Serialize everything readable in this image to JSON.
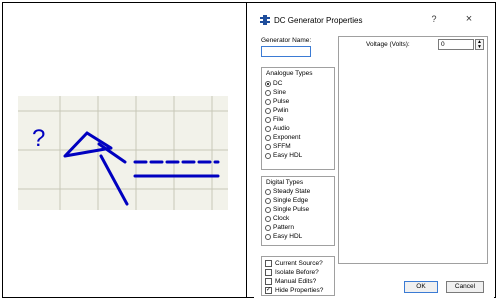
{
  "dialog": {
    "title": "DC Generator Properties",
    "help": "?",
    "close": "×",
    "generator_name_label": "Generator Name:",
    "generator_name_value": "",
    "analogue_group_title": "Analogue Types",
    "analogue_types": [
      "DC",
      "Sine",
      "Pulse",
      "Pwlin",
      "File",
      "Audio",
      "Exponent",
      "SFFM",
      "Easy HDL"
    ],
    "analogue_selected": "DC",
    "digital_group_title": "Digital Types",
    "digital_types": [
      "Steady State",
      "Single Edge",
      "Single Pulse",
      "Clock",
      "Pattern",
      "Easy HDL"
    ],
    "checkboxes": [
      {
        "label": "Current Source?",
        "checked": false
      },
      {
        "label": "Isolate Before?",
        "checked": false
      },
      {
        "label": "Manual Edits?",
        "checked": false
      },
      {
        "label": "Hide Properties?",
        "checked": true
      }
    ],
    "voltage_label": "Voltage (Volts):",
    "voltage_value": "0",
    "ok_label": "OK",
    "cancel_label": "Cancel"
  },
  "schematic": {
    "generator_value": "?",
    "wire_color": "#0000c0",
    "grid_color": "#c8c8b8",
    "background_color": "#f2f2ea"
  }
}
